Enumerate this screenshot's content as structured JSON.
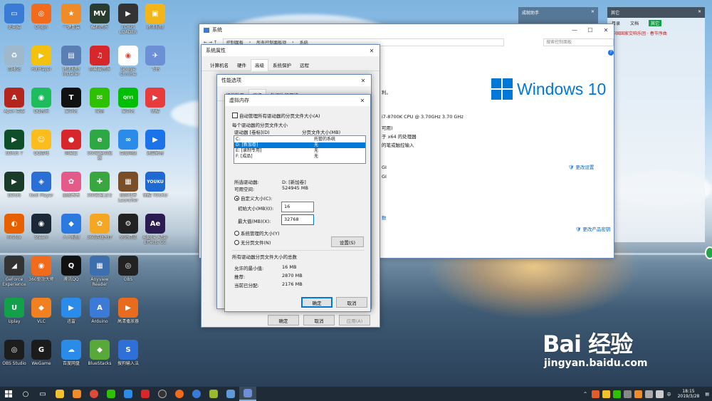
{
  "desktop_icons": [
    {
      "label": "此电脑",
      "color": "#3a7bd5",
      "glyph": "▭"
    },
    {
      "label": "Origin",
      "color": "#f26a1b",
      "glyph": "◎"
    },
    {
      "label": "一键重装",
      "color": "#f08b2a",
      "glyph": "★"
    },
    {
      "label": "酷狗音乐",
      "color": "#2a3b2f",
      "glyph": "MV"
    },
    {
      "label": "EDIUS LOADER",
      "color": "#333",
      "glyph": "▶"
    },
    {
      "label": "腾讯视频",
      "color": "#f2b51a",
      "glyph": "▣"
    },
    {
      "label": "回收站",
      "color": "#9fb8cc",
      "glyph": "♻"
    },
    {
      "label": "PotPlayer",
      "color": "#f4c20d",
      "glyph": "▶"
    },
    {
      "label": "腾讯视频 Installer",
      "color": "#5a7fb5",
      "glyph": "▤"
    },
    {
      "label": "网易云音乐",
      "color": "#d7272a",
      "glyph": "♫"
    },
    {
      "label": "Google Chrome",
      "color": "#fff",
      "glyph": "◉"
    },
    {
      "label": "飞书",
      "color": "#6c8fd5",
      "glyph": "✈"
    },
    {
      "label": "Apex 英雄",
      "color": "#b3261e",
      "glyph": "A"
    },
    {
      "label": "QQ音乐",
      "color": "#1ebc5c",
      "glyph": "◉"
    },
    {
      "label": "爱奇艺",
      "color": "#111",
      "glyph": "T"
    },
    {
      "label": "微信",
      "color": "#2dc100",
      "glyph": "✉"
    },
    {
      "label": "爱奇艺",
      "color": "#00be06",
      "glyph": "QIYI"
    },
    {
      "label": "优酷",
      "color": "#e83b3b",
      "glyph": "▶"
    },
    {
      "label": "EDIUS 7",
      "color": "#0e4f2a",
      "glyph": "▶"
    },
    {
      "label": "QQ游戏",
      "color": "#fbbd1d",
      "glyph": "☺"
    },
    {
      "label": "网易云",
      "color": "#d7272a",
      "glyph": "●"
    },
    {
      "label": "360安全浏览器",
      "color": "#2ea843",
      "glyph": "e"
    },
    {
      "label": "百度网盘",
      "color": "#2b8be8",
      "glyph": "∞"
    },
    {
      "label": "迅雷影音",
      "color": "#1a73e8",
      "glyph": "▶"
    },
    {
      "label": "EDIUS",
      "color": "#1b3c2a",
      "glyph": "▶"
    },
    {
      "label": "Kodi Player",
      "color": "#2b6fd4",
      "glyph": "◈"
    },
    {
      "label": "美图秀秀",
      "color": "#e45b8a",
      "glyph": "✿"
    },
    {
      "label": "360安全卫士",
      "color": "#3aa640",
      "glyph": "✚"
    },
    {
      "label": "我的世界 Launcher",
      "color": "#7b4e2a",
      "glyph": "▦"
    },
    {
      "label": "优酷 YOUKU",
      "color": "#1e6ad2",
      "glyph": "YOUKU"
    },
    {
      "label": "Firefox",
      "color": "#e66000",
      "glyph": "◐"
    },
    {
      "label": "Steam",
      "color": "#1b2838",
      "glyph": "◉"
    },
    {
      "label": "人人视频",
      "color": "#2c79e0",
      "glyph": "◆"
    },
    {
      "label": "360游戏大厅",
      "color": "#f5a623",
      "glyph": "✿"
    },
    {
      "label": "驱动精灵",
      "color": "#222",
      "glyph": "⚙"
    },
    {
      "label": "Adobe After Effects CC",
      "color": "#2a1b50",
      "glyph": "Ae"
    },
    {
      "label": "GeForce Experience",
      "color": "#333",
      "glyph": "◢"
    },
    {
      "label": "360驱动大师",
      "color": "#f26a1b",
      "glyph": "◉"
    },
    {
      "label": "腾讯QQ",
      "color": "#111",
      "glyph": "Q"
    },
    {
      "label": "Anyview Reader",
      "color": "#3d6fae",
      "glyph": "▦"
    },
    {
      "label": "OBS",
      "color": "#222",
      "glyph": "◎"
    },
    {
      "label": "",
      "color": "transparent",
      "glyph": ""
    },
    {
      "label": "Uplay",
      "color": "#13a04a",
      "glyph": "U"
    },
    {
      "label": "VLC",
      "color": "#f08020",
      "glyph": "◆"
    },
    {
      "label": "迅雷",
      "color": "#2a8be8",
      "glyph": "▶"
    },
    {
      "label": "Arduino",
      "color": "#3b7ad6",
      "glyph": "A"
    },
    {
      "label": "高清播放器",
      "color": "#e86b1e",
      "glyph": "▶"
    },
    {
      "label": "",
      "color": "transparent",
      "glyph": ""
    },
    {
      "label": "OBS Studio",
      "color": "#1d1d1d",
      "glyph": "◎"
    },
    {
      "label": "WeGame",
      "color": "#1b1b1b",
      "glyph": "G"
    },
    {
      "label": "百度网盘",
      "color": "#2b8be8",
      "glyph": "☁"
    },
    {
      "label": "BlueStacks",
      "color": "#58a83a",
      "glyph": "◆"
    },
    {
      "label": "搜狗输入法",
      "color": "#2e6fd8",
      "glyph": "S"
    },
    {
      "label": "",
      "color": "transparent",
      "glyph": ""
    }
  ],
  "system_window": {
    "title": "系统",
    "breadcrumb": [
      "控制面板",
      "所有控制面板项",
      "系统"
    ],
    "search_placeholder": "搜索控制面板",
    "windows_brand": "Windows 10",
    "cpu": "i7-8700K CPU @ 3.70GHz   3.70 GHz",
    "usable": "可用)",
    "os_type": "于 x64 的处理器",
    "pen": "的笔或触控输入",
    "change_settings": "更改设置",
    "change_key": "更改产品密钥",
    "partial_copy": "利。",
    "gi1": "GI",
    "gi2": "GI",
    "nums": "数"
  },
  "sys_props": {
    "title": "系统属性",
    "tabs": [
      "计算机名",
      "硬件",
      "高级",
      "系统保护",
      "远程"
    ],
    "active_tab": 2,
    "ok": "确定",
    "cancel": "取消",
    "apply": "应用(A)"
  },
  "perf_options": {
    "title": "性能选项",
    "tabs": [
      "视觉效果",
      "高级",
      "数据执行保护"
    ]
  },
  "virtual_memory": {
    "title": "虚拟内存",
    "auto_manage": "自动管理所有驱动器的分页文件大小(A)",
    "per_drive_title": "每个驱动器的分页文件大小",
    "col_drive": "驱动器 [卷标](D)",
    "col_size": "分页文件大小(MB)",
    "drives": [
      {
        "drive": "C:",
        "size": "托管的系统",
        "selected": false
      },
      {
        "drive": "D:    [新加卷]",
        "size": "无",
        "selected": true
      },
      {
        "drive": "E:    [录制专用]",
        "size": "无",
        "selected": false
      },
      {
        "drive": "F:    [成品]",
        "size": "无",
        "selected": false
      }
    ],
    "selected_drive_label": "所选驱动器:",
    "selected_drive_value": "D:  [新加卷]",
    "free_space_label": "可用空间:",
    "free_space_value": "524945 MB",
    "custom_size": "自定义大小(C):",
    "initial_label": "初始大小(MB)(I):",
    "initial_value": "16",
    "max_label": "最大值(MB)(X):",
    "max_value": "32768",
    "system_managed": "系统管理的大小(Y)",
    "no_paging": "无分页文件(N)",
    "set_button": "设置(S)",
    "total_title": "所有驱动器分页文件大小的总数",
    "min_label": "允许的最小值:",
    "min_value": "16 MB",
    "recommended_label": "推荐:",
    "recommended_value": "2870 MB",
    "current_label": "当前已分配:",
    "current_value": "2176 MB",
    "ok": "确定",
    "cancel": "取消"
  },
  "right_panel": {
    "title1": "成就助手",
    "title2": "其它",
    "menu": [
      "目录",
      "文档",
      "其它"
    ],
    "news": "中国国家交响乐团 · 春节序曲"
  },
  "taskbar": {
    "time": "18:15",
    "date": "2019/3/28"
  },
  "watermark": {
    "brand": "Bai 经验",
    "url": "jingyan.baidu.com"
  }
}
